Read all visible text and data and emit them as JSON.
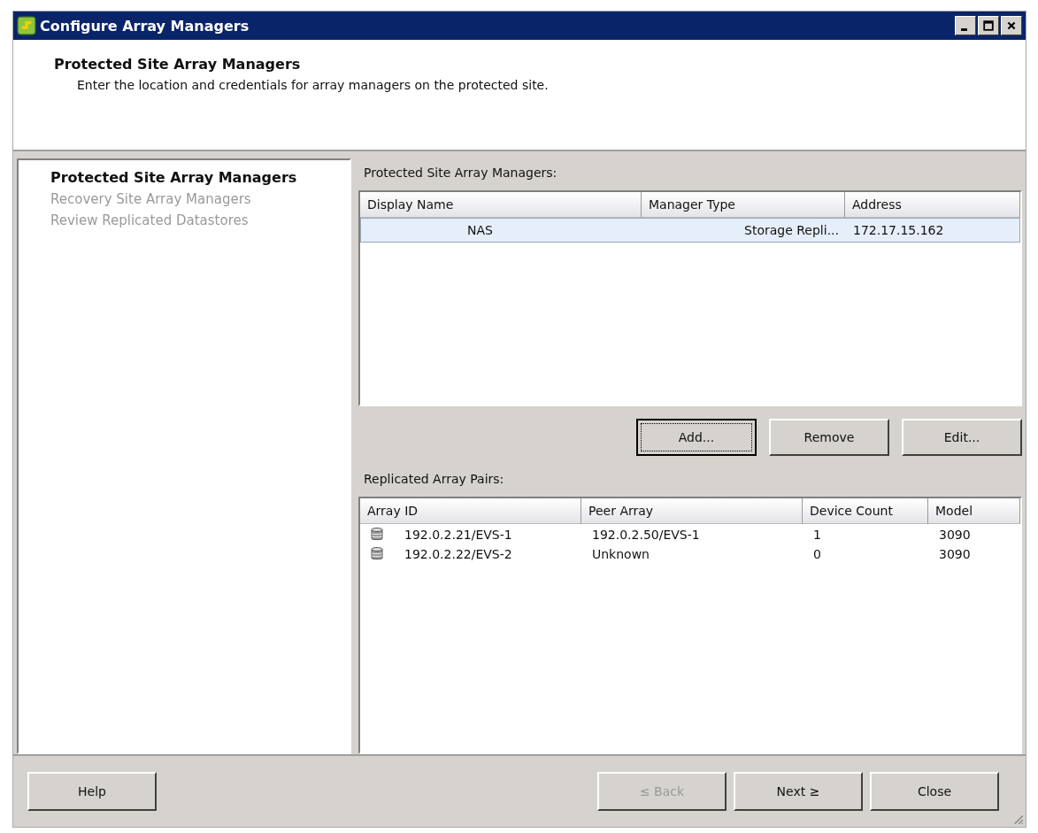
{
  "window": {
    "title": "Configure Array Managers"
  },
  "header": {
    "title": "Protected Site Array Managers",
    "description": "Enter the location and credentials for array managers on the protected site."
  },
  "steps": [
    {
      "label": "Protected Site Array Managers",
      "selected": true
    },
    {
      "label": "Recovery Site Array Managers",
      "selected": false
    },
    {
      "label": "Review Replicated Datastores",
      "selected": false
    }
  ],
  "managers": {
    "label": "Protected Site Array Managers:",
    "columns": [
      "Display Name",
      "Manager Type",
      "Address"
    ],
    "rows": [
      {
        "cells": [
          "NAS",
          "Storage Repli...",
          "172.17.15.162"
        ],
        "selected": true
      }
    ]
  },
  "manager_buttons": [
    {
      "label": "Add...",
      "focused": true
    },
    {
      "label": "Remove",
      "focused": false
    },
    {
      "label": "Edit...",
      "focused": false
    }
  ],
  "pairs": {
    "label": "Replicated Array Pairs:",
    "columns": [
      "Array ID",
      "Peer Array",
      "Device Count",
      "Model"
    ],
    "rows": [
      {
        "cells": [
          "192.0.2.21/EVS-1",
          "192.0.2.50/EVS-1",
          "1",
          "3090"
        ]
      },
      {
        "cells": [
          "192.0.2.22/EVS-2",
          "Unknown",
          "0",
          "3090"
        ]
      }
    ]
  },
  "footer_buttons": [
    {
      "label": "Help",
      "disabled": false,
      "kind": "left"
    },
    {
      "label": "≤ Back",
      "disabled": true,
      "kind": "right"
    },
    {
      "label": "Next ≥",
      "disabled": false,
      "kind": "right"
    },
    {
      "label": "Close",
      "disabled": false,
      "kind": "right"
    }
  ]
}
